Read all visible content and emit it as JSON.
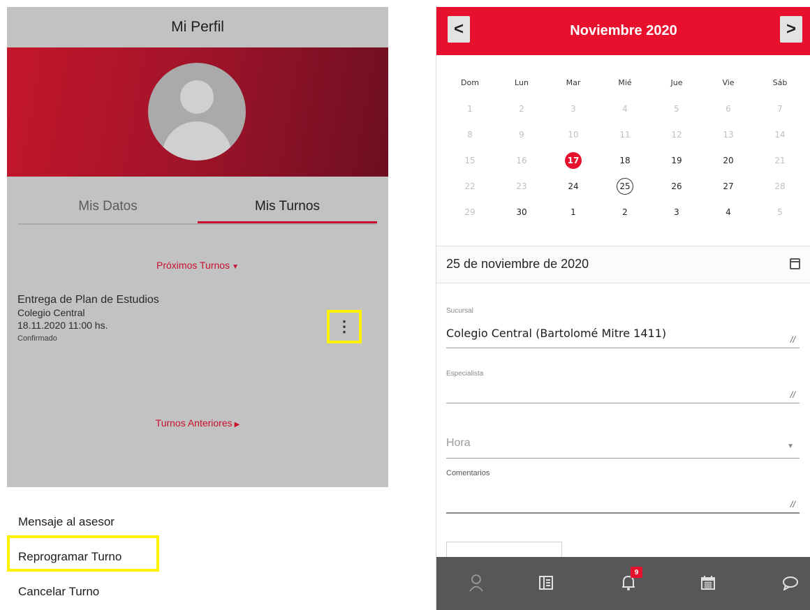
{
  "left": {
    "title": "Mi Perfil",
    "tabs": [
      {
        "label": "Mis Datos"
      },
      {
        "label": "Mis Turnos"
      }
    ],
    "upcoming_header": "Próximos Turnos",
    "appointment": {
      "title": "Entrega de Plan de Estudios",
      "location": "Colegio Central",
      "datetime": "18.11.2020 11:00 hs.",
      "status": "Confirmado"
    },
    "kebab_glyph": "⋮",
    "past_header": "Turnos Anteriores",
    "sheet": [
      {
        "label": "Mensaje al asesor"
      },
      {
        "label": "Reprogramar Turno"
      },
      {
        "label": "Cancelar Turno"
      }
    ],
    "highlight_color": "#fff200"
  },
  "right": {
    "calendar": {
      "title": "Noviembre 2020",
      "prev": "<",
      "next": ">",
      "weekdays": [
        "Dom",
        "Lun",
        "Mar",
        "Mié",
        "Jue",
        "Vie",
        "Sáb"
      ],
      "weeks": [
        [
          "1",
          "2",
          "3",
          "4",
          "5",
          "6",
          "7"
        ],
        [
          "8",
          "9",
          "10",
          "11",
          "12",
          "13",
          "14"
        ],
        [
          "15",
          "16",
          "17",
          "18",
          "19",
          "20",
          "21"
        ],
        [
          "22",
          "23",
          "24",
          "25",
          "26",
          "27",
          "28"
        ],
        [
          "29",
          "30",
          "1",
          "2",
          "3",
          "4",
          "5"
        ]
      ],
      "enabled_positions": [
        [
          2,
          2
        ],
        [
          2,
          3
        ],
        [
          2,
          4
        ],
        [
          2,
          5
        ],
        [
          3,
          2
        ],
        [
          3,
          3
        ],
        [
          3,
          4
        ],
        [
          3,
          5
        ],
        [
          4,
          1
        ],
        [
          4,
          2
        ],
        [
          4,
          3
        ],
        [
          4,
          4
        ],
        [
          4,
          5
        ]
      ],
      "today_position": [
        2,
        2
      ],
      "selected_position": [
        3,
        3
      ],
      "accent": "#e8112d"
    },
    "selected_date": "25 de noviembre de 2020",
    "form": {
      "sucursal_label": "Sucursal",
      "sucursal_value": "Colegio Central (Bartolomé Mitre 1411)",
      "especialista_label": "Especialista",
      "especialista_value": "",
      "hora_label": "Hora",
      "comentarios_label": "Comentarios",
      "comentarios_value": ""
    },
    "bottom_nav": [
      {
        "icon": "user-icon"
      },
      {
        "icon": "news-icon"
      },
      {
        "icon": "bell-icon",
        "badge": "9"
      },
      {
        "icon": "calendar-icon"
      },
      {
        "icon": "chat-icon"
      }
    ]
  }
}
